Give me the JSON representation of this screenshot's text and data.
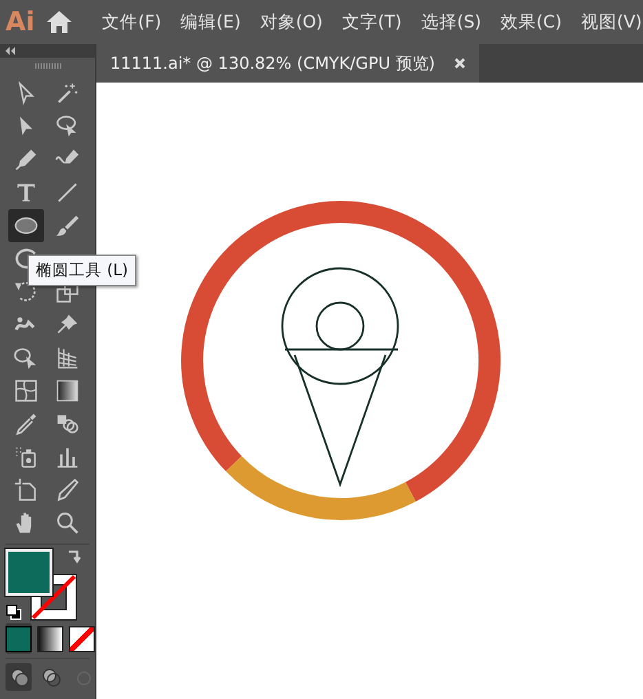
{
  "menubar": {
    "logo": "Ai",
    "menus": [
      "文件(F)",
      "编辑(E)",
      "对象(O)",
      "文字(T)",
      "选择(S)",
      "效果(C)",
      "视图(V)"
    ]
  },
  "document_tab": {
    "title": "11111.ai*  @ 130.82% (CMYK/GPU 预览)",
    "selected": true
  },
  "tools": [
    {
      "kind": "direct",
      "selected": false
    },
    {
      "kind": "wand",
      "selected": false
    },
    {
      "kind": "select",
      "selected": false
    },
    {
      "kind": "lasso",
      "selected": false
    },
    {
      "kind": "pen",
      "selected": false
    },
    {
      "kind": "curvature",
      "selected": false
    },
    {
      "kind": "type",
      "selected": false
    },
    {
      "kind": "line",
      "selected": false
    },
    {
      "kind": "ellipse",
      "selected": true
    },
    {
      "kind": "brush",
      "selected": false
    },
    {
      "kind": "shaper",
      "selected": false
    },
    {
      "kind": "rotate",
      "selected": false
    },
    {
      "kind": "scale",
      "selected": false
    },
    {
      "kind": "warp",
      "selected": false
    },
    {
      "kind": "pin",
      "selected": false
    },
    {
      "kind": "builder",
      "selected": false
    },
    {
      "kind": "perspective",
      "selected": false
    },
    {
      "kind": "mesh",
      "selected": false
    },
    {
      "kind": "gradient",
      "selected": false
    },
    {
      "kind": "eyedropper",
      "selected": false
    },
    {
      "kind": "blend",
      "selected": false
    },
    {
      "kind": "sprayer",
      "selected": false
    },
    {
      "kind": "graph",
      "selected": false
    },
    {
      "kind": "artboard",
      "selected": false
    },
    {
      "kind": "slice",
      "selected": false
    },
    {
      "kind": "hand",
      "selected": false
    },
    {
      "kind": "zoom",
      "selected": false
    }
  ],
  "tooltip": "椭圆工具 (L)",
  "fill_stroke": {
    "fill": {
      "color": "#0d6b5c"
    }
  },
  "color_modes": [
    {
      "kind": "color",
      "selected": true
    },
    {
      "kind": "gradient",
      "selected": false
    },
    {
      "kind": "none",
      "selected": false
    }
  ],
  "draw_modes": [
    {
      "selected": true
    },
    {
      "selected": false
    },
    {
      "selected": false
    }
  ]
}
